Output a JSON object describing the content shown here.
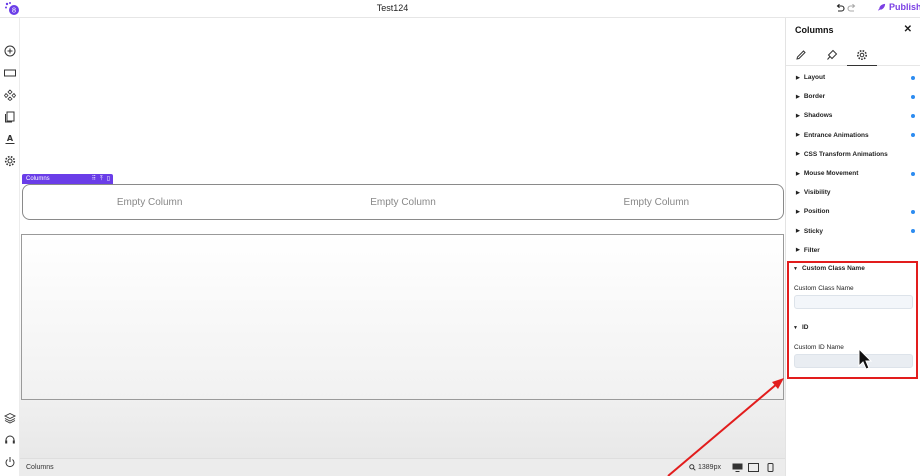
{
  "window": {
    "title": "Test124"
  },
  "toolbar": {
    "publish_label": "Publish",
    "publish_color": "#7b3fe4"
  },
  "left_sidebar": {
    "top_icons": [
      "add-icon",
      "container-icon",
      "components-icon",
      "pages-icon",
      "typography-icon",
      "settings-icon"
    ],
    "bottom_icons": [
      "layers-icon",
      "help-icon",
      "power-icon"
    ]
  },
  "canvas": {
    "selected_tag_label": "Columns",
    "columns": [
      {
        "label": "Empty Column"
      },
      {
        "label": "Empty Column"
      },
      {
        "label": "Empty Column"
      }
    ],
    "accent": "#6a3de8"
  },
  "bottom_bar": {
    "breadcrumb": "Columns",
    "width_readout": "1389px"
  },
  "panel": {
    "title": "Columns",
    "tabs": [
      "pencil-icon",
      "brush-icon",
      "gear-icon"
    ],
    "active_tab": 2,
    "sections": [
      {
        "label": "Layout",
        "modified": true
      },
      {
        "label": "Border",
        "modified": true
      },
      {
        "label": "Shadows",
        "modified": true
      },
      {
        "label": "Entrance Animations",
        "modified": true
      },
      {
        "label": "CSS Transform Animations",
        "modified": false
      },
      {
        "label": "Mouse Movement",
        "modified": true
      },
      {
        "label": "Visibility",
        "modified": false
      },
      {
        "label": "Position",
        "modified": true
      },
      {
        "label": "Sticky",
        "modified": true
      },
      {
        "label": "Filter",
        "modified": false
      }
    ],
    "custom_class": {
      "heading": "Custom Class Name",
      "field_label": "Custom Class Name",
      "value": ""
    },
    "id_section": {
      "heading": "ID",
      "field_label": "Custom ID Name",
      "value": ""
    },
    "modified_dot_color": "#2d8cf0"
  },
  "annotation": {
    "color": "#e21d1d"
  }
}
